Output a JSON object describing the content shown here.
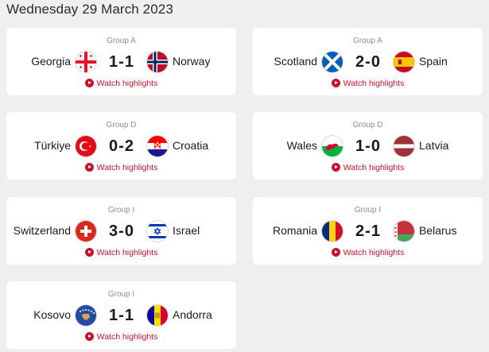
{
  "date_heading": "Wednesday 29 March 2023",
  "colors": {
    "accent": "#c4122f",
    "card_bg": "#ffffff",
    "page_bg": "#efeff0"
  },
  "matches": [
    {
      "group": "Group A",
      "home": "Georgia",
      "away": "Norway",
      "score": "1-1",
      "home_flag": "georgia-flag-icon",
      "away_flag": "norway-flag-icon",
      "watch": "Watch highlights"
    },
    {
      "group": "Group A",
      "home": "Scotland",
      "away": "Spain",
      "score": "2-0",
      "home_flag": "scotland-flag-icon",
      "away_flag": "spain-flag-icon",
      "watch": "Watch highlights"
    },
    {
      "group": "Group D",
      "home": "Türkiye",
      "away": "Croatia",
      "score": "0-2",
      "home_flag": "turkiye-flag-icon",
      "away_flag": "croatia-flag-icon",
      "watch": "Watch highlights"
    },
    {
      "group": "Group D",
      "home": "Wales",
      "away": "Latvia",
      "score": "1-0",
      "home_flag": "wales-flag-icon",
      "away_flag": "latvia-flag-icon",
      "watch": "Watch highlights"
    },
    {
      "group": "Group I",
      "home": "Switzerland",
      "away": "Israel",
      "score": "3-0",
      "home_flag": "switzerland-flag-icon",
      "away_flag": "israel-flag-icon",
      "watch": "Watch highlights"
    },
    {
      "group": "Group I",
      "home": "Romania",
      "away": "Belarus",
      "score": "2-1",
      "home_flag": "romania-flag-icon",
      "away_flag": "belarus-flag-icon",
      "watch": "Watch highlights"
    },
    {
      "group": "Group I",
      "home": "Kosovo",
      "away": "Andorra",
      "score": "1-1",
      "home_flag": "kosovo-flag-icon",
      "away_flag": "andorra-flag-icon",
      "watch": "Watch highlights"
    }
  ]
}
